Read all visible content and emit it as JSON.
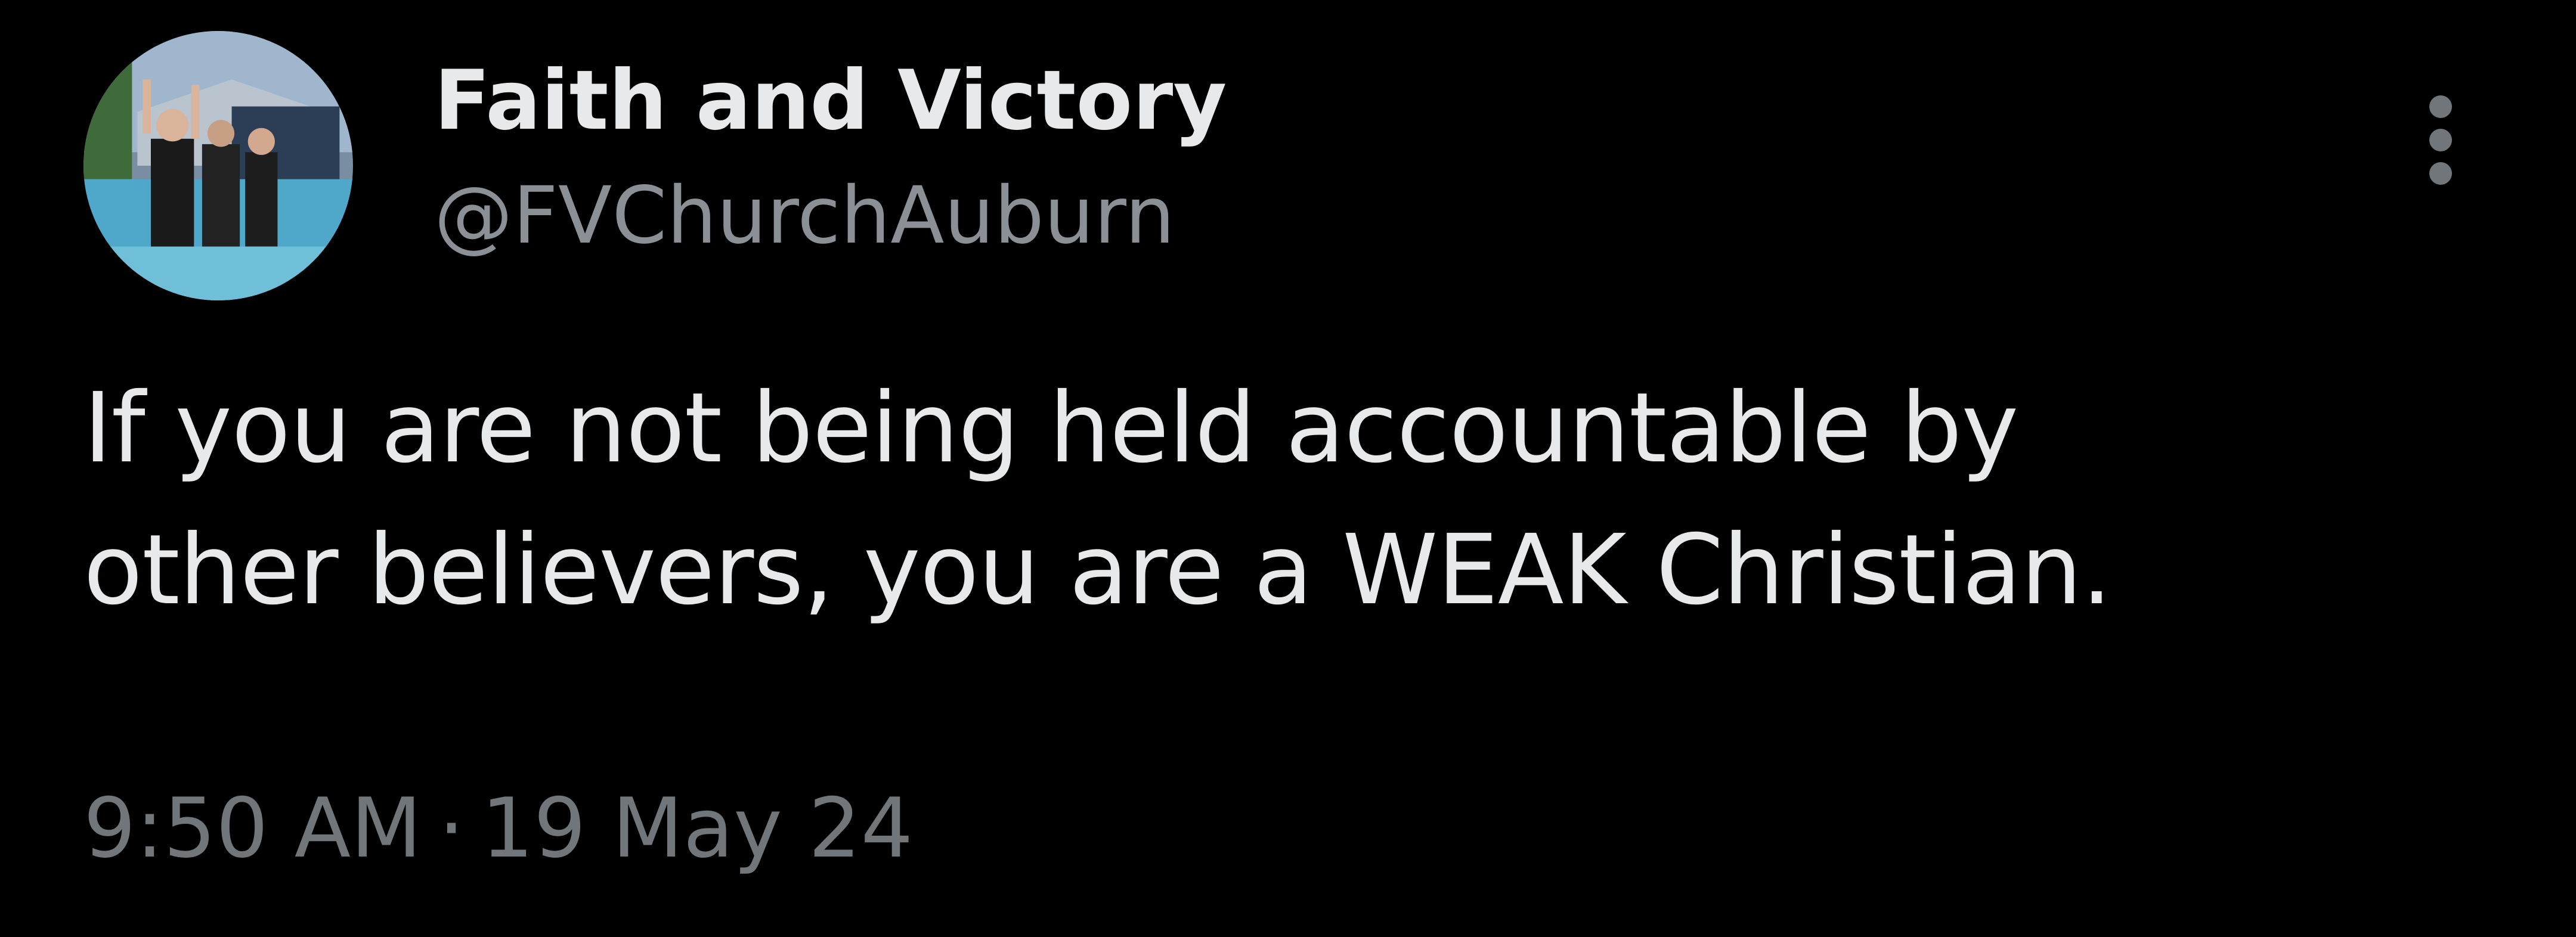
{
  "author": {
    "display_name": "Faith and Victory",
    "handle": "@FVChurchAuburn",
    "avatar_icon": "profile-photo"
  },
  "more_menu": {
    "icon": "more-vertical-icon"
  },
  "tweet": {
    "lines": [
      "If you are not being held accountable by",
      "other believers, you are a WEAK Christian."
    ]
  },
  "meta": {
    "time": "9:50 AM",
    "separator": "·",
    "date": "19 May 24"
  },
  "colors": {
    "background": "#000000",
    "primary_text": "#e7e9ea",
    "secondary_text": "#71767b"
  }
}
